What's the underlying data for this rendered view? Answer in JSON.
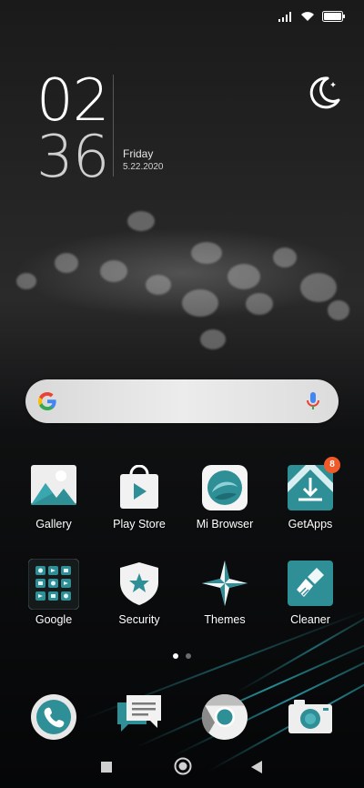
{
  "status_bar": {
    "icons": [
      "signal-icon",
      "wifi-icon",
      "battery-icon"
    ]
  },
  "clock": {
    "hour": "02",
    "minute": "36",
    "day": "Friday",
    "date": "5.22.2020"
  },
  "search": {
    "icons": [
      "google-g-icon",
      "mic-icon"
    ]
  },
  "apps": [
    {
      "label": "Gallery"
    },
    {
      "label": "Play Store"
    },
    {
      "label": "Mi Browser"
    },
    {
      "label": "GetApps",
      "badge": "8"
    },
    {
      "label": "Google"
    },
    {
      "label": "Security"
    },
    {
      "label": "Themes"
    },
    {
      "label": "Cleaner"
    }
  ],
  "dock": [
    "phone-icon",
    "messages-icon",
    "chrome-icon",
    "camera-icon"
  ],
  "page_indicator": {
    "pages": 2,
    "current": 1
  },
  "nav_bar": [
    "recents-button",
    "home-button",
    "back-button"
  ],
  "colors": {
    "accent": "#2f8f97",
    "badge": "#f05a28"
  }
}
